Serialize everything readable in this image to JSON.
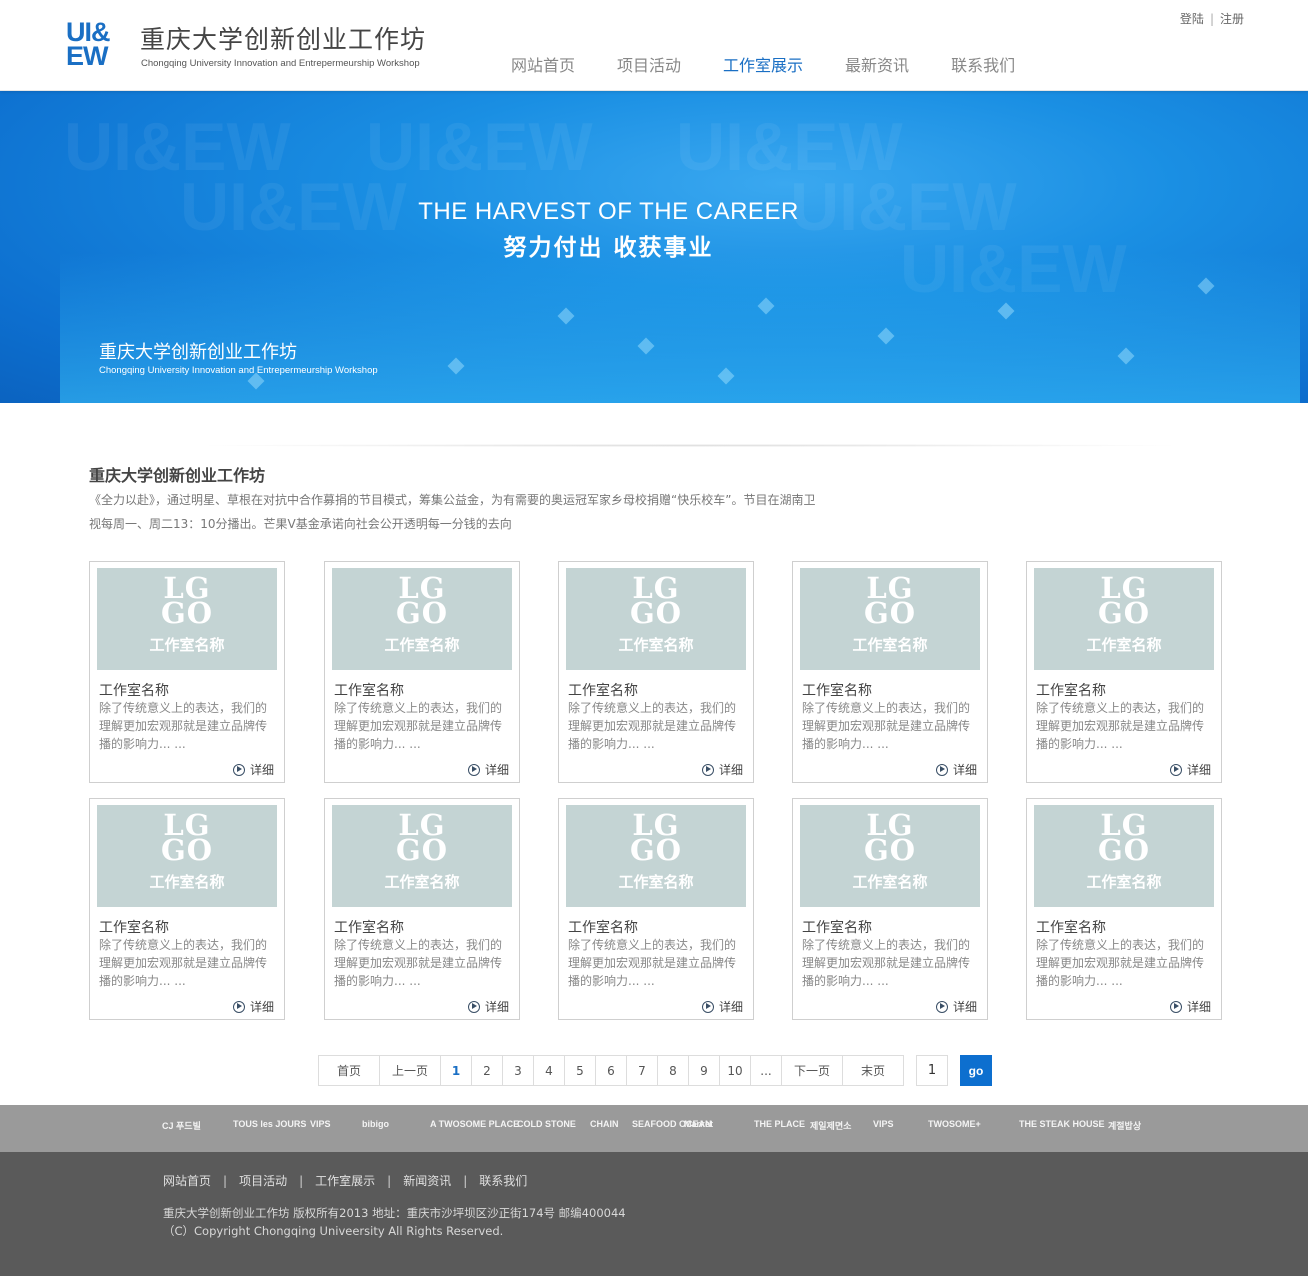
{
  "header": {
    "logo_line1": "UI&",
    "logo_line2": "EW",
    "title_cn": "重庆大学创新创业工作坊",
    "title_en": "Chongqing University Innovation and Entrepermeurship Workshop",
    "login": "登陆",
    "sep": "|",
    "register": "注册"
  },
  "nav": [
    {
      "label": "网站首页"
    },
    {
      "label": "项目活动"
    },
    {
      "label": "工作室展示",
      "active": true
    },
    {
      "label": "最新资讯"
    },
    {
      "label": "联系我们"
    }
  ],
  "banner": {
    "watermark": "UI&EW",
    "title_en": "THE HARVEST OF THE CAREER",
    "title_cn": "努力付出 收获事业",
    "sub_cn": "重庆大学创新创业工作坊",
    "sub_en": "Chongqing University Innovation and Entrepermeurship Workshop"
  },
  "section": {
    "title": "重庆大学创新创业工作坊",
    "desc": "《全力以赴》，通过明星、草根在对抗中合作募捐的节目模式，筹集公益金，为有需要的奥运冠军家乡母校捐赠“快乐校车”。节目在湖南卫视每周一、周二13：10分播出。芒果V基金承诺向社会公开透明每一分钱的去向"
  },
  "card": {
    "logo_top": "LG",
    "logo_bottom": "GO",
    "thumb_name": "工作室名称",
    "title": "工作室名称",
    "desc": "除了传统意义上的表达，我们的理解更加宏观那就是建立品牌传播的影响力... ...",
    "more": "详细"
  },
  "pager": {
    "first": "首页",
    "prev": "上一页",
    "pages": [
      "1",
      "2",
      "3",
      "4",
      "5",
      "6",
      "7",
      "8",
      "9",
      "10",
      "..."
    ],
    "current": "1",
    "next": "下一页",
    "last": "末页",
    "input": "1",
    "go": "go"
  },
  "partners": [
    "CJ 푸드빌",
    "TOUS les JOURS",
    "VIPS",
    "bibigo",
    "A TWOSOME PLACE",
    "COLD STONE",
    "CHAIN",
    "SEAFOOD OCEAN",
    "Market",
    "THE PLACE",
    "제일제면소",
    "VIPS",
    "TWOSOME+",
    "THE STEAK HOUSE",
    "계절밥상"
  ],
  "footer": {
    "links": [
      "网站首页",
      "项目活动",
      "工作室展示",
      "新闻资讯",
      "联系我们"
    ],
    "sep": "|",
    "copy1": "重庆大学创新创业工作坊 版权所有2013  地址：重庆市沙坪坝区沙正街174号  邮编400044",
    "copy2": "（C）Copyright Chongqing Univeersity All Rights Reserved."
  }
}
